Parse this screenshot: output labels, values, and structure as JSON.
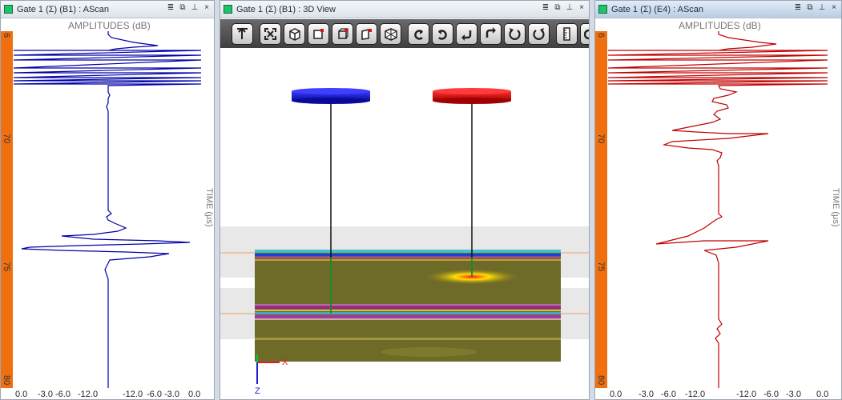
{
  "left_panel": {
    "title": "Gate 1 (Σ) (B1) : AScan",
    "amp_label": "AMPLITUDES (dB)",
    "time_label": "TIME (μs)",
    "y_ticks": [
      "6",
      "70",
      "75",
      "80"
    ],
    "x_ticks": [
      "0.0",
      "-3.0",
      "-6.0",
      "-12.0",
      "-12.0",
      "-6.0",
      "-3.0",
      "0.0"
    ],
    "trace_color": "#0000a8"
  },
  "center_panel": {
    "title": "Gate 1 (Σ) (B1) : 3D View",
    "toolbar_icons": [
      "pointer-icon",
      "fit-view-icon",
      "cube-solid-icon",
      "cube-front-icon",
      "cube-wire-icon",
      "cube-side-icon",
      "cube-iso-icon",
      "rotate-up-icon",
      "rotate-down-icon",
      "rotate-left-icon",
      "rotate-right-icon",
      "rotate-ccw-icon",
      "rotate-cw-icon",
      "ruler-icon",
      "more-icon"
    ],
    "axes": {
      "x": "X",
      "z": "Z"
    },
    "probe_colors": {
      "probe1": "#1a1adc",
      "probe2": "#e01010"
    }
  },
  "right_panel": {
    "title": "Gate 1 (Σ) (E4) : AScan",
    "amp_label": "AMPLITUDES (dB)",
    "time_label": "TIME (μs)",
    "y_ticks": [
      "6",
      "70",
      "75",
      "80"
    ],
    "x_ticks": [
      "0.0",
      "-3.0",
      "-6.0",
      "-12.0",
      "-12.0",
      "-6.0",
      "-3.0",
      "0.0"
    ],
    "trace_color": "#c00000"
  },
  "window_controls": {
    "data": "≣",
    "restore": "⧉",
    "pin": "⊥",
    "close": "×"
  }
}
